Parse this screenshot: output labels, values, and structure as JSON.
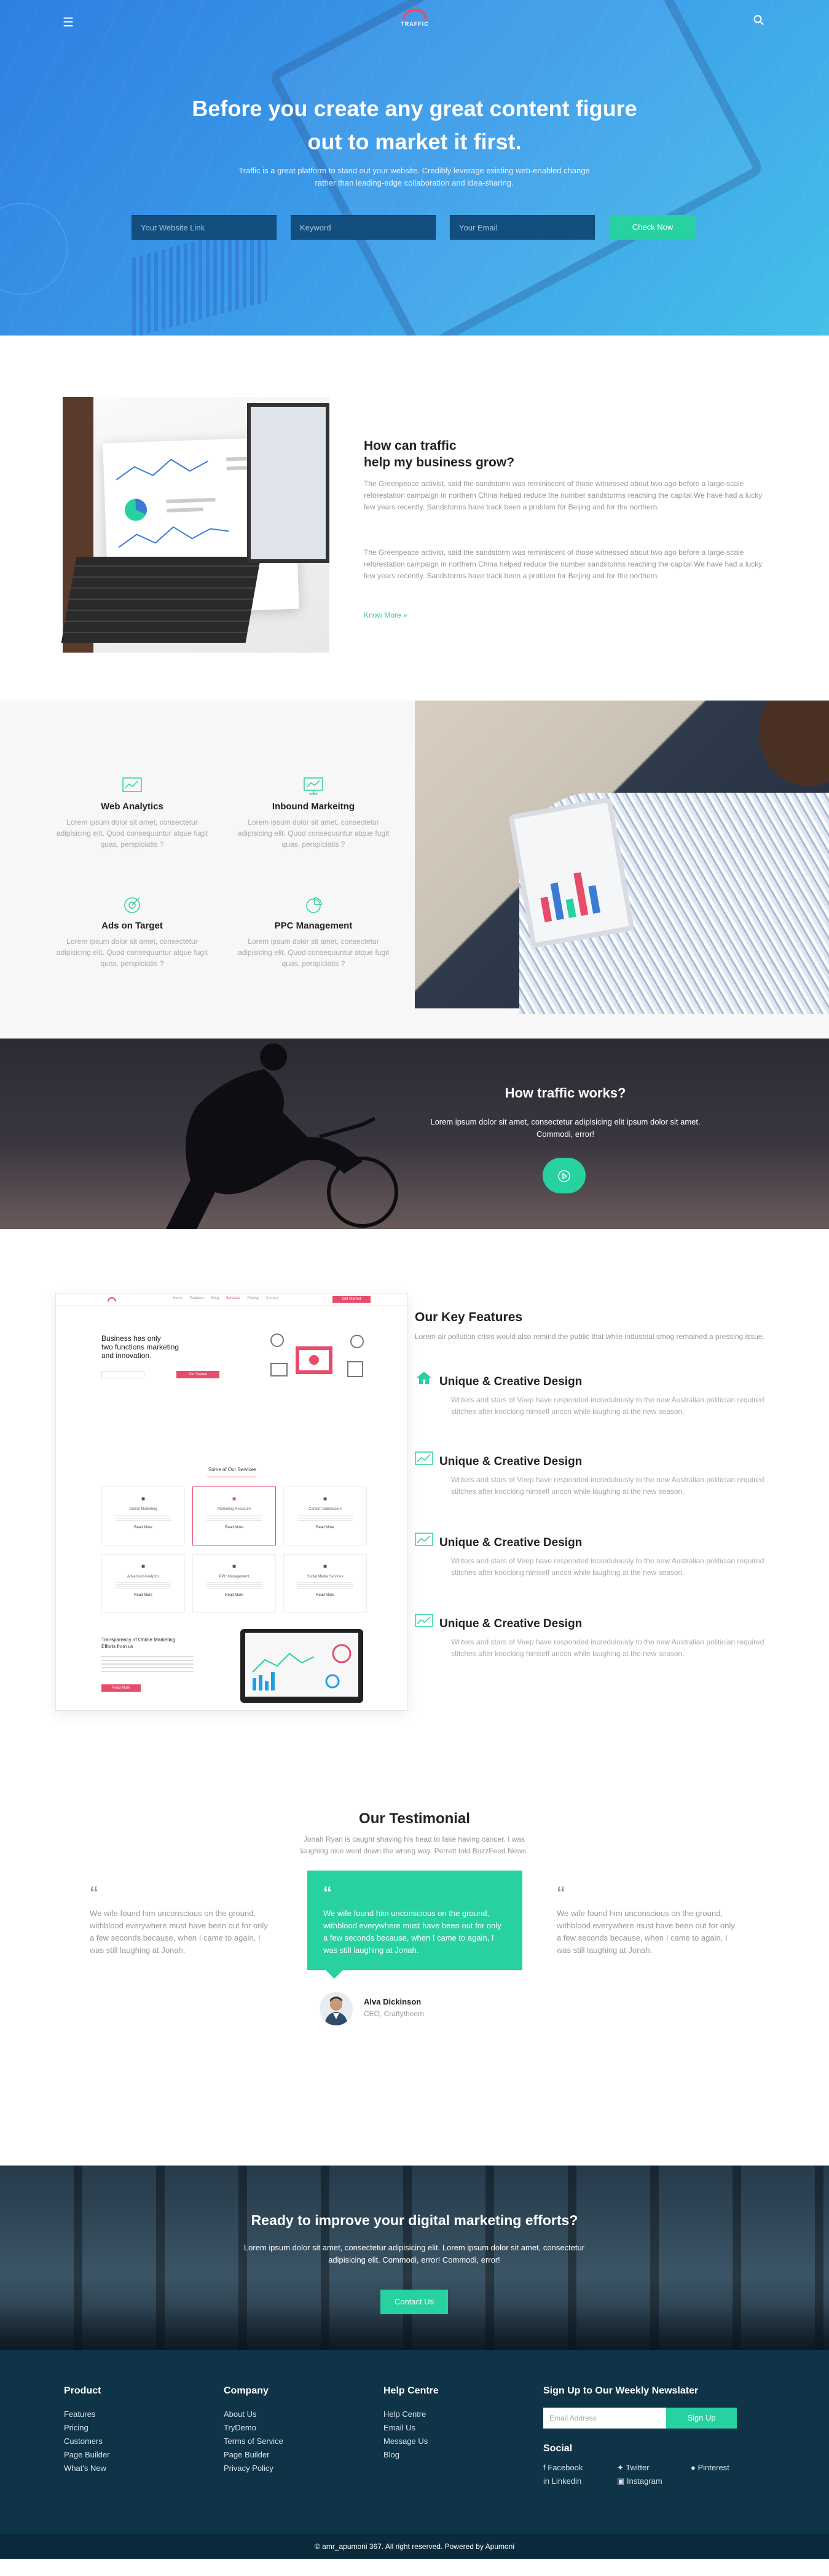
{
  "header": {
    "logo_text": "TRAFFIC",
    "title": "Before you create any great content figure out to market it first.",
    "subtitle": "Traffic is a great platform to stand out your website. Credibly leverage existing web-enabled change rather than leading-edge collaboration and idea-sharing.",
    "inputs": {
      "website": "Your Website Link",
      "keyword": "Keyword",
      "email": "Your Email"
    },
    "check_button": "Check Now",
    "menu_icon": "hamburger-icon",
    "search_icon": "search-icon"
  },
  "grow": {
    "title_line1": "How can traffic",
    "title_line2": "help my business grow?",
    "para1": "The Greenpeace activist, said the sandstorm was reminiscent of those witnessed about two ago before a large-scale reforestation campaign in northern China helped reduce the number sandstorms reaching the capital.We have had a lucky few years recently. Sandstorms have track been a problem for Beijing and for the northern.",
    "para2": "The Greenpeace activist, said the sandstorm was reminiscent of those witnessed about two ago before a large-scale reforestation campaign in northern China helped reduce the number sandstorms reaching the capital.We have had a lucky few years recently. Sandstorms have track been a problem for Beijing and for the northern.",
    "more": "Know More"
  },
  "services": [
    {
      "title": "Web Analytics",
      "icon": "line-chart-icon",
      "text": "Lorem ipsum dolor sit amet, consectetur adipisicing elit. Quod consequuntur atque fugit quas, perspiciatis ?"
    },
    {
      "title": "Inbound Markeitng",
      "icon": "monitor-chart-icon",
      "text": "Lorem ipsum dolor sit amet, consectetur adipisicing elit. Quod consequuntur atque fugit quas, perspiciatis ?"
    },
    {
      "title": "Ads on Target",
      "icon": "target-icon",
      "text": "Lorem ipsum dolor sit amet, consectetur adipisicing elit. Quod consequuntur atque fugit quas, perspiciatis ?"
    },
    {
      "title": "PPC Management",
      "icon": "pie-chart-icon",
      "text": "Lorem ipsum dolor sit amet, consectetur adipisicing elit. Quod consequuntur atque fugit quas, perspiciatis ?"
    }
  ],
  "works": {
    "title": "How traffic works?",
    "text": "Lorem ipsum dolor sit amet, consectetur adipisicing elit ipsum dolor sit amet. Commodi, error!",
    "play_icon": "play-icon"
  },
  "mock": {
    "nav": [
      "Home",
      "Features",
      "Blog",
      "Services",
      "Pricing",
      "Contact"
    ],
    "nav_button": "Get Started",
    "hero_line1": "Business has only",
    "hero_line2": "two functions marketing",
    "hero_line3": "and innovation.",
    "hero_button": "Get Started",
    "services_title": "Some of Our Services",
    "cards": [
      "Online Marketing",
      "Marketing Research",
      "Content Submission",
      "Advanced Analytics",
      "PPC Management",
      "Social Media Services"
    ],
    "card_link": "Read More",
    "bottom_line1": "Transparency of Online Marketing",
    "bottom_line2": "Efforts from us",
    "bottom_button": "Read More"
  },
  "features": {
    "title": "Our Key Features",
    "intro": "Lorem air pollution crisis would also remind the public that while industrial smog remained a pressing issue.",
    "items": [
      {
        "icon": "home-icon",
        "title": "Unique & Creative Design",
        "text": "Writers and stars of Veep have responded incredulously to the new Australian politician required stitches after knocking himself uncon while laughing at the new season."
      },
      {
        "icon": "chart-area-icon",
        "title": "Unique & Creative Design",
        "text": "Writers and stars of Veep have responded incredulously to the new Australian politician required stitches after knocking himself uncon while laughing at the new season."
      },
      {
        "icon": "chart-area-icon",
        "title": "Unique & Creative Design",
        "text": "Writers and stars of Veep have responded incredulously to the new Australian politician required stitches after knocking himself uncon while laughing at the new season."
      },
      {
        "icon": "chart-area-icon",
        "title": "Unique & Creative Design",
        "text": "Writers and stars of Veep have responded incredulously to the new Australian politician required stitches after knocking himself uncon while laughing at the new season."
      }
    ]
  },
  "testimonial": {
    "title": "Our Testimonial",
    "intro": "Jonah Ryan is caught shaving his head to fake having cancer. I was laughing nice went down the wrong way. Perrett told BuzzFeed News.",
    "quote_mark": "“",
    "quotes": [
      "We wife found him unconscious on the ground, withblood everywhere must have been out for only a few seconds because, when I came to again, I was still laughing at Jonah.",
      "We wife found him unconscious on the ground, withblood everywhere must have been out for only a few seconds because, when I came to again, I was still laughing at Jonah.",
      "We wife found him unconscious on the ground, withblood everywhere must have been out for only a few seconds because, when I came to again, I was still laughing at Jonah."
    ],
    "name": "Alva Dickinson",
    "role": "CEO, Craftytheem"
  },
  "cta": {
    "title": "Ready to improve your digital marketing efforts?",
    "text": "Lorem ipsum dolor sit amet, consectetur adipisicing elit. Lorem ipsum dolor sit amet, consectetur adipisicing elit. Commodi, error! Commodi, error!",
    "button": "Contact Us"
  },
  "footer": {
    "product": {
      "title": "Product",
      "links": [
        "Features",
        "Pricing",
        "Customers",
        "Page Builder",
        "What's New"
      ]
    },
    "company": {
      "title": "Company",
      "links": [
        "About Us",
        "TryDemo",
        "Terms of Service",
        "Page Builder",
        "Privacy Policy"
      ]
    },
    "help": {
      "title": "Help Centre",
      "links": [
        "Help Centre",
        "Email Us",
        "Message Us",
        "Blog"
      ]
    },
    "newsletter_title": "Sign Up to Our Weekly Newslater",
    "email_placeholder": "Email Address",
    "signup_button": "Sign Up",
    "social_title": "Social",
    "social": [
      "Facebook",
      "Twitter",
      "Pinterest",
      "Linkedin",
      "Instagram"
    ],
    "copyright": "© amr_apumoni 367. All right reserved. Powered by Apumoni"
  },
  "colors": {
    "accent": "#27d1a0",
    "brand_pink": "#e84c6b",
    "footer": "#0f3347",
    "hero_blue": "#3da0ea"
  }
}
